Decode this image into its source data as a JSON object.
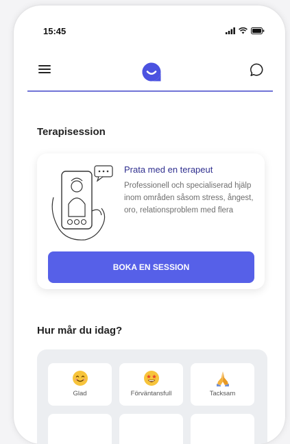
{
  "status_bar": {
    "time": "15:45"
  },
  "therapy": {
    "section_title": "Terapisession",
    "card_title": "Prata med en terapeut",
    "card_text": "Professionell och specialiserad hjälp inom områden såsom stress, ångest, oro, relationsproblem med flera",
    "book_button": "BOKA EN SESSION"
  },
  "mood": {
    "section_title": "Hur mår du idag?",
    "options": [
      {
        "label": "Glad",
        "icon": "smiling-face-icon"
      },
      {
        "label": "Förväntansfull",
        "icon": "star-struck-face-icon"
      },
      {
        "label": "Tacksam",
        "icon": "praying-hands-icon"
      }
    ]
  },
  "colors": {
    "accent": "#5660e8",
    "divider": "#6f73d6",
    "card_title": "#2f2f8f"
  }
}
